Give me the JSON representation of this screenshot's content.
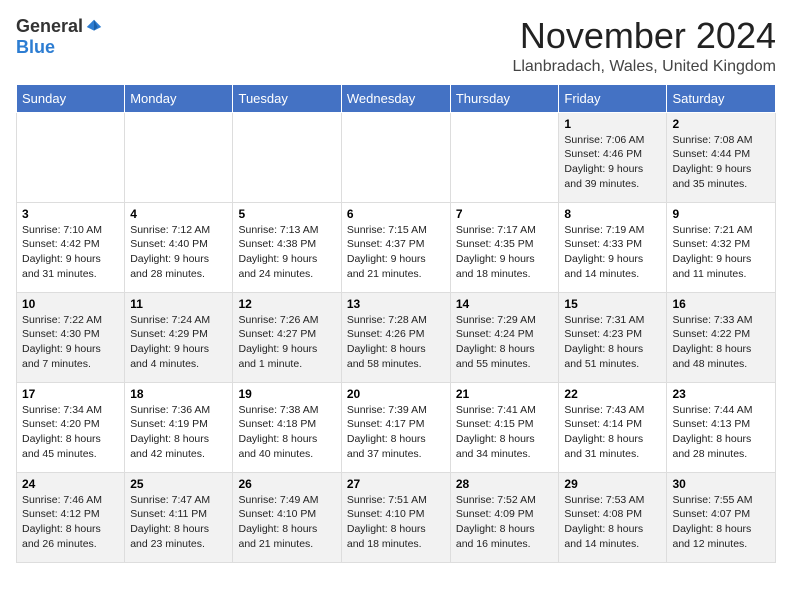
{
  "logo": {
    "general": "General",
    "blue": "Blue"
  },
  "header": {
    "month": "November 2024",
    "location": "Llanbradach, Wales, United Kingdom"
  },
  "weekdays": [
    "Sunday",
    "Monday",
    "Tuesday",
    "Wednesday",
    "Thursday",
    "Friday",
    "Saturday"
  ],
  "weeks": [
    [
      {
        "day": "",
        "info": ""
      },
      {
        "day": "",
        "info": ""
      },
      {
        "day": "",
        "info": ""
      },
      {
        "day": "",
        "info": ""
      },
      {
        "day": "",
        "info": ""
      },
      {
        "day": "1",
        "info": "Sunrise: 7:06 AM\nSunset: 4:46 PM\nDaylight: 9 hours and 39 minutes."
      },
      {
        "day": "2",
        "info": "Sunrise: 7:08 AM\nSunset: 4:44 PM\nDaylight: 9 hours and 35 minutes."
      }
    ],
    [
      {
        "day": "3",
        "info": "Sunrise: 7:10 AM\nSunset: 4:42 PM\nDaylight: 9 hours and 31 minutes."
      },
      {
        "day": "4",
        "info": "Sunrise: 7:12 AM\nSunset: 4:40 PM\nDaylight: 9 hours and 28 minutes."
      },
      {
        "day": "5",
        "info": "Sunrise: 7:13 AM\nSunset: 4:38 PM\nDaylight: 9 hours and 24 minutes."
      },
      {
        "day": "6",
        "info": "Sunrise: 7:15 AM\nSunset: 4:37 PM\nDaylight: 9 hours and 21 minutes."
      },
      {
        "day": "7",
        "info": "Sunrise: 7:17 AM\nSunset: 4:35 PM\nDaylight: 9 hours and 18 minutes."
      },
      {
        "day": "8",
        "info": "Sunrise: 7:19 AM\nSunset: 4:33 PM\nDaylight: 9 hours and 14 minutes."
      },
      {
        "day": "9",
        "info": "Sunrise: 7:21 AM\nSunset: 4:32 PM\nDaylight: 9 hours and 11 minutes."
      }
    ],
    [
      {
        "day": "10",
        "info": "Sunrise: 7:22 AM\nSunset: 4:30 PM\nDaylight: 9 hours and 7 minutes."
      },
      {
        "day": "11",
        "info": "Sunrise: 7:24 AM\nSunset: 4:29 PM\nDaylight: 9 hours and 4 minutes."
      },
      {
        "day": "12",
        "info": "Sunrise: 7:26 AM\nSunset: 4:27 PM\nDaylight: 9 hours and 1 minute."
      },
      {
        "day": "13",
        "info": "Sunrise: 7:28 AM\nSunset: 4:26 PM\nDaylight: 8 hours and 58 minutes."
      },
      {
        "day": "14",
        "info": "Sunrise: 7:29 AM\nSunset: 4:24 PM\nDaylight: 8 hours and 55 minutes."
      },
      {
        "day": "15",
        "info": "Sunrise: 7:31 AM\nSunset: 4:23 PM\nDaylight: 8 hours and 51 minutes."
      },
      {
        "day": "16",
        "info": "Sunrise: 7:33 AM\nSunset: 4:22 PM\nDaylight: 8 hours and 48 minutes."
      }
    ],
    [
      {
        "day": "17",
        "info": "Sunrise: 7:34 AM\nSunset: 4:20 PM\nDaylight: 8 hours and 45 minutes."
      },
      {
        "day": "18",
        "info": "Sunrise: 7:36 AM\nSunset: 4:19 PM\nDaylight: 8 hours and 42 minutes."
      },
      {
        "day": "19",
        "info": "Sunrise: 7:38 AM\nSunset: 4:18 PM\nDaylight: 8 hours and 40 minutes."
      },
      {
        "day": "20",
        "info": "Sunrise: 7:39 AM\nSunset: 4:17 PM\nDaylight: 8 hours and 37 minutes."
      },
      {
        "day": "21",
        "info": "Sunrise: 7:41 AM\nSunset: 4:15 PM\nDaylight: 8 hours and 34 minutes."
      },
      {
        "day": "22",
        "info": "Sunrise: 7:43 AM\nSunset: 4:14 PM\nDaylight: 8 hours and 31 minutes."
      },
      {
        "day": "23",
        "info": "Sunrise: 7:44 AM\nSunset: 4:13 PM\nDaylight: 8 hours and 28 minutes."
      }
    ],
    [
      {
        "day": "24",
        "info": "Sunrise: 7:46 AM\nSunset: 4:12 PM\nDaylight: 8 hours and 26 minutes."
      },
      {
        "day": "25",
        "info": "Sunrise: 7:47 AM\nSunset: 4:11 PM\nDaylight: 8 hours and 23 minutes."
      },
      {
        "day": "26",
        "info": "Sunrise: 7:49 AM\nSunset: 4:10 PM\nDaylight: 8 hours and 21 minutes."
      },
      {
        "day": "27",
        "info": "Sunrise: 7:51 AM\nSunset: 4:10 PM\nDaylight: 8 hours and 18 minutes."
      },
      {
        "day": "28",
        "info": "Sunrise: 7:52 AM\nSunset: 4:09 PM\nDaylight: 8 hours and 16 minutes."
      },
      {
        "day": "29",
        "info": "Sunrise: 7:53 AM\nSunset: 4:08 PM\nDaylight: 8 hours and 14 minutes."
      },
      {
        "day": "30",
        "info": "Sunrise: 7:55 AM\nSunset: 4:07 PM\nDaylight: 8 hours and 12 minutes."
      }
    ]
  ]
}
